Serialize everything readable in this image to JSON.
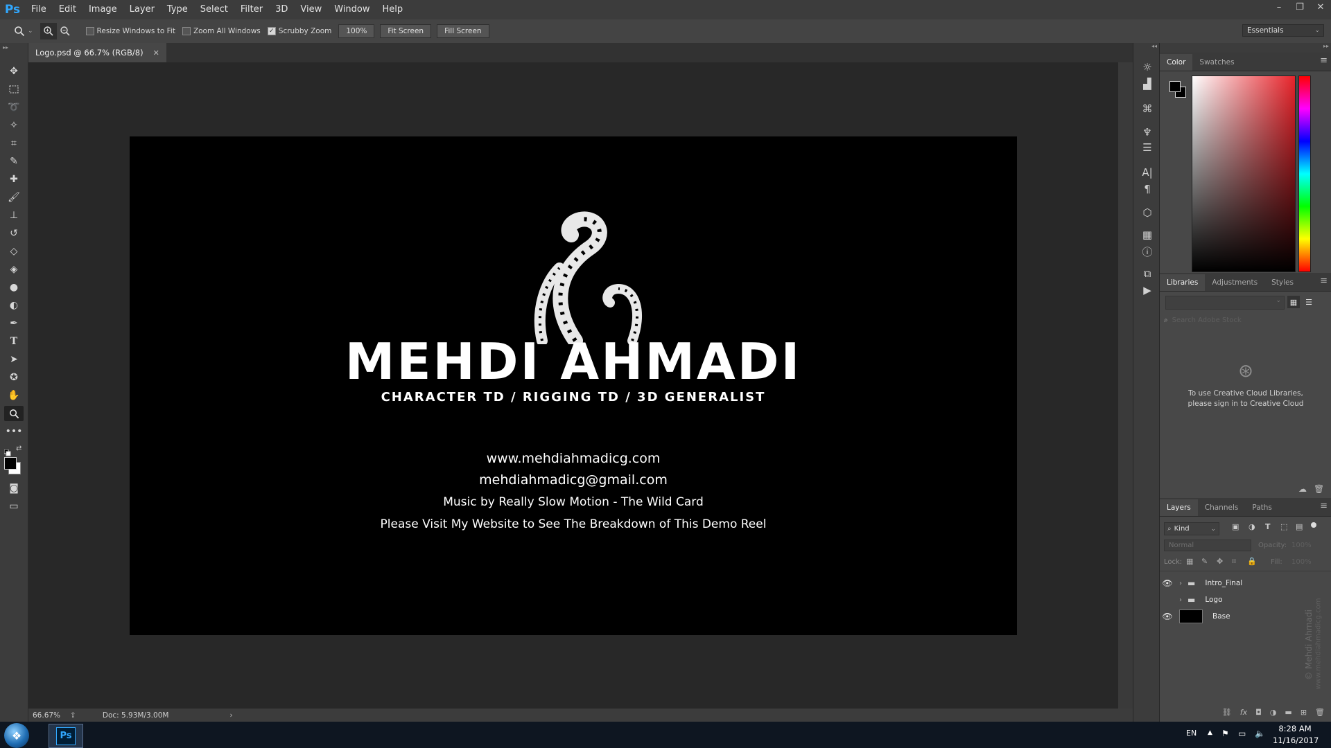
{
  "app": {
    "logo": "Ps"
  },
  "menu": [
    "File",
    "Edit",
    "Image",
    "Layer",
    "Type",
    "Select",
    "Filter",
    "3D",
    "View",
    "Window",
    "Help"
  ],
  "window_controls": {
    "minimize": "–",
    "restore": "❐",
    "close": "✕"
  },
  "options": {
    "resize_windows": "Resize Windows to Fit",
    "resize_checked": false,
    "zoom_all": "Zoom All Windows",
    "zoom_all_checked": false,
    "scrubby_zoom": "Scrubby Zoom",
    "scrubby_checked": true,
    "zoom_value": "100%",
    "fit_screen": "Fit Screen",
    "fill_screen": "Fill Screen",
    "workspace": "Essentials"
  },
  "document": {
    "tab_title": "Logo.psd @ 66.7% (RGB/8)",
    "zoom": "66.67%",
    "doc_size": "Doc: 5.93M/3.00M"
  },
  "artboard": {
    "name": "MEHDI AHMADI",
    "tagline": "CHARACTER TD / RIGGING TD / 3D GENERALIST",
    "website": "www.mehdiahmadicg.com",
    "email": "mehdiahmadicg@gmail.com",
    "music": "Music by Really Slow Motion - The Wild Card",
    "visit": "Please Visit My Website to See The  Breakdown of This Demo Reel"
  },
  "color_panel": {
    "tabs": [
      "Color",
      "Swatches"
    ],
    "active": "Color",
    "colors": {
      "hue_base": "#e8242b"
    }
  },
  "libraries_panel": {
    "tabs": [
      "Libraries",
      "Adjustments",
      "Styles"
    ],
    "active": "Libraries",
    "search_placeholder": "Search Adobe Stock",
    "message": "To use Creative Cloud Libraries, please sign in to Creative Cloud"
  },
  "layers_panel": {
    "tabs": [
      "Layers",
      "Channels",
      "Paths"
    ],
    "active": "Layers",
    "kind_filter": "Kind",
    "blend_mode": "Normal",
    "opacity_label": "Opacity:",
    "opacity": "100%",
    "lock_label": "Lock:",
    "fill_label": "Fill:",
    "fill": "100%",
    "layers": [
      {
        "name": "Intro_Final",
        "type": "group",
        "visible": true
      },
      {
        "name": "Logo",
        "type": "group",
        "visible": false
      },
      {
        "name": "Base",
        "type": "pixel",
        "visible": true
      }
    ]
  },
  "watermark": {
    "line1": "© Mehdi Ahmadi",
    "line2": "www.mehdiahmadicg.com"
  },
  "taskbar": {
    "lang": "EN",
    "time": "8:28 AM",
    "date": "11/16/2017",
    "ps_label": "Ps"
  }
}
